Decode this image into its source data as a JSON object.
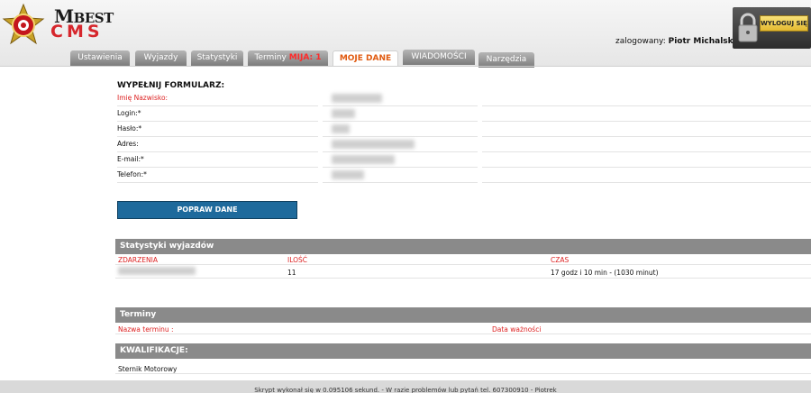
{
  "header": {
    "logo_m": "M",
    "logo_best": "BEST",
    "logo_cms": "CMS",
    "logged_label": "zalogowany:",
    "logged_user": "Piotr Michalski",
    "logout_label": "WYLOGUJ SIĘ"
  },
  "tabs": [
    {
      "label": "Ustawienia"
    },
    {
      "label": "Wyjazdy"
    },
    {
      "label": "Statystyki"
    },
    {
      "label": "Terminy",
      "badge": "MIJA: 1"
    },
    {
      "label": "MOJE DANE"
    },
    {
      "label": "WIADOMOŚCI"
    },
    {
      "label": "Narzędzia"
    }
  ],
  "form": {
    "title": "WYPEŁNIJ FORMULARZ:",
    "fields": [
      {
        "label": "Imię Nazwisko:"
      },
      {
        "label": "Login:*"
      },
      {
        "label": "Hasło:*"
      },
      {
        "label": "Adres:"
      },
      {
        "label": "E-mail:*"
      },
      {
        "label": "Telefon:*"
      }
    ],
    "submit_label": "POPRAW DANE"
  },
  "stats": {
    "title": "Statystyki wyjazdów",
    "columns": [
      "ZDARZENIA",
      "ILOŚĆ",
      "CZAS"
    ],
    "rows": [
      {
        "count": "11",
        "time": "17 godz i 10 min - (1030 minut)"
      }
    ]
  },
  "terms": {
    "title": "Terminy",
    "columns": [
      "Nazwa terminu :",
      "Data ważności"
    ]
  },
  "qualifications": {
    "title": "KWALIFIKACJE:",
    "items": [
      "Sternik Motorowy"
    ]
  },
  "footer": {
    "text": "Skrypt wykonał się w 0.095106 sekund. - W razie problemów lub pytań tel. 607300910 - Piotrek"
  }
}
